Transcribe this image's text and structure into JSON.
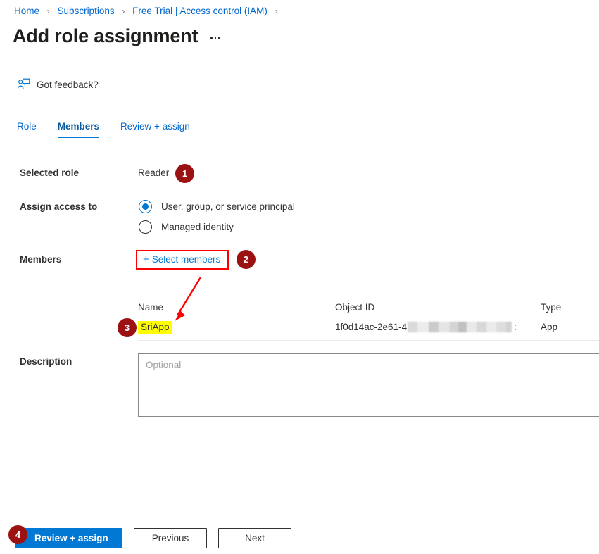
{
  "breadcrumb": {
    "items": [
      "Home",
      "Subscriptions",
      "Free Trial | Access control (IAM)"
    ],
    "separator": "›",
    "trailing_separator": "›"
  },
  "header": {
    "title": "Add role assignment",
    "ellipsis_label": "···"
  },
  "feedback": {
    "label": "Got feedback?",
    "icon": "person-feedback-icon"
  },
  "tabs": [
    {
      "label": "Role",
      "active": false
    },
    {
      "label": "Members",
      "active": true
    },
    {
      "label": "Review + assign",
      "active": false
    }
  ],
  "form": {
    "selected_role": {
      "label": "Selected role",
      "value": "Reader"
    },
    "assign_access_to": {
      "label": "Assign access to",
      "options": [
        {
          "label": "User, group, or service principal",
          "selected": true
        },
        {
          "label": "Managed identity",
          "selected": false
        }
      ]
    },
    "members": {
      "label": "Members",
      "select_members_link": "Select members",
      "plus_glyph": "+"
    },
    "description": {
      "label": "Description",
      "placeholder": "Optional",
      "value": ""
    }
  },
  "members_table": {
    "columns": [
      "Name",
      "Object ID",
      "Type"
    ],
    "rows": [
      {
        "name": "SriApp",
        "object_id_visible": "1f0d14ac-2e61-4",
        "object_id_redacted": true,
        "object_id_tail": ":",
        "type": "App"
      }
    ]
  },
  "footer": {
    "primary_button": "Review + assign",
    "previous_button": "Previous",
    "next_button": "Next"
  },
  "annotations": {
    "badges": [
      {
        "number": "1",
        "target": "selected-role-value"
      },
      {
        "number": "2",
        "target": "select-members-link"
      },
      {
        "number": "3",
        "target": "member-name-sriapp"
      },
      {
        "number": "4",
        "target": "review-assign-button"
      }
    ],
    "highlight_color": "#ffff00",
    "callout_color": "#ff0000",
    "badge_color": "#9c1111"
  },
  "colors": {
    "accent": "#0078d4",
    "link": "#0066cc",
    "text": "#323130",
    "divider": "#e1dfdd"
  }
}
